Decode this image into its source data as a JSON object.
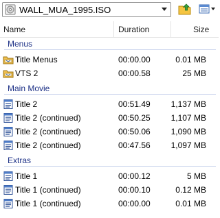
{
  "toolbar": {
    "disc_name": "WALL_MUA_1995.ISO",
    "icons": [
      "disc-icon",
      "dropdown-arrow-icon",
      "folder-up-icon",
      "view-menu-icon"
    ]
  },
  "columns": {
    "name": "Name",
    "duration": "Duration",
    "size": "Size"
  },
  "groups": [
    {
      "label": "Menus",
      "items": [
        {
          "name": "Title Menus",
          "duration": "00:00.00",
          "size": "0.01 MB",
          "icon": "menu-folder-icon"
        },
        {
          "name": "VTS 2",
          "duration": "00:00.58",
          "size": "25 MB",
          "icon": "menu-folder-icon"
        }
      ]
    },
    {
      "label": "Main Movie",
      "items": [
        {
          "name": "Title 2",
          "duration": "00:51.49",
          "size": "1,137 MB",
          "icon": "title-icon"
        },
        {
          "name": "Title 2 (continued)",
          "duration": "00:50.25",
          "size": "1,107 MB",
          "icon": "title-icon"
        },
        {
          "name": "Title 2 (continued)",
          "duration": "00:50.06",
          "size": "1,090 MB",
          "icon": "title-icon"
        },
        {
          "name": "Title 2 (continued)",
          "duration": "00:47.56",
          "size": "1,097 MB",
          "icon": "title-icon"
        }
      ]
    },
    {
      "label": "Extras",
      "items": [
        {
          "name": "Title 1",
          "duration": "00:00.12",
          "size": "5 MB",
          "icon": "title-icon"
        },
        {
          "name": "Title 1 (continued)",
          "duration": "00:00.10",
          "size": "0.12 MB",
          "icon": "title-icon"
        },
        {
          "name": "Title 1 (continued)",
          "duration": "00:00.00",
          "size": "0.01 MB",
          "icon": "title-icon"
        }
      ]
    }
  ]
}
